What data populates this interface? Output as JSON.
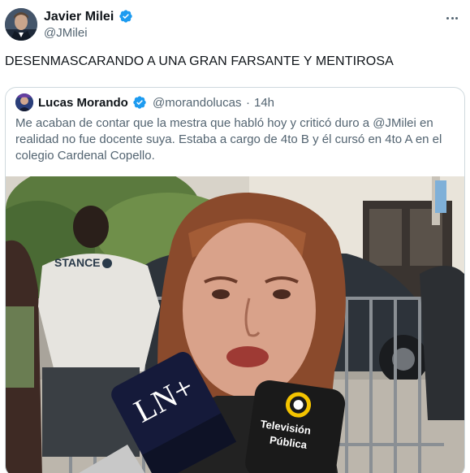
{
  "tweet": {
    "author_name": "Javier Milei",
    "author_handle": "@JMilei",
    "text": "DESENMASCARANDO A UNA GRAN FARSANTE Y MENTIROSA",
    "more_icon": "more-horizontal-icon",
    "verified_icon": "verified-badge-icon"
  },
  "quoted": {
    "author_name": "Lucas Morando",
    "author_handle": "@morandolucas",
    "separator": "·",
    "time": "14h",
    "text": "Me acaban de contar que la mestra que habló hoy y criticó duro a @JMilei en realidad no fue docente suya. Estaba a cargo de 4to B y él cursó en 4to A en el colegio Cardenal Copello.",
    "media": {
      "shirt_text": "STANCE",
      "mic_left_logo": "LN+",
      "mic_right_line1": "Televisión",
      "mic_right_line2": "Pública"
    }
  },
  "colors": {
    "text_primary": "#0f1419",
    "text_secondary": "#536471",
    "verified_blue": "#1d9bf0",
    "border": "#cfd9de"
  }
}
